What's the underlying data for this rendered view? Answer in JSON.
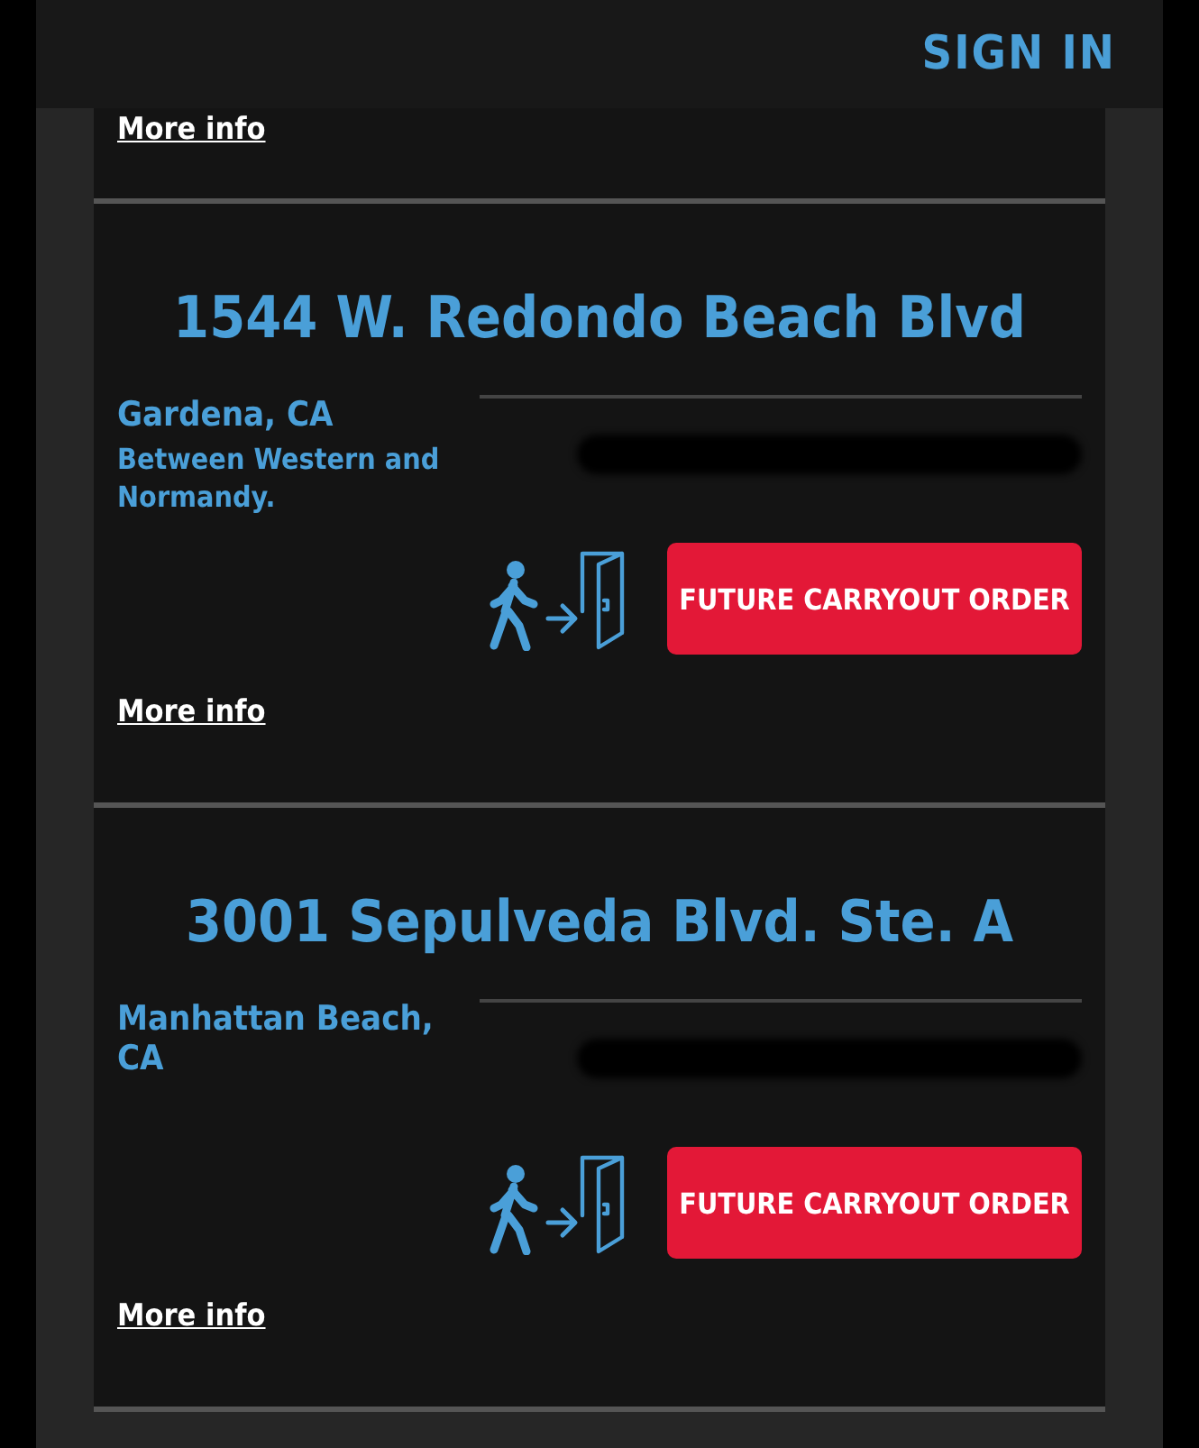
{
  "header": {
    "sign_in": "SIGN IN"
  },
  "top_link": "More info",
  "stores": [
    {
      "address": "1544 W. Redondo Beach Blvd",
      "city": "Gardena, CA",
      "note": "Between Western and Normandy.",
      "button": "FUTURE CARRYOUT ORDER",
      "link": "More info"
    },
    {
      "address": "3001 Sepulveda Blvd. Ste. A",
      "city": "Manhattan Beach, CA",
      "button": "FUTURE CARRYOUT ORDER",
      "link": "More info"
    }
  ]
}
